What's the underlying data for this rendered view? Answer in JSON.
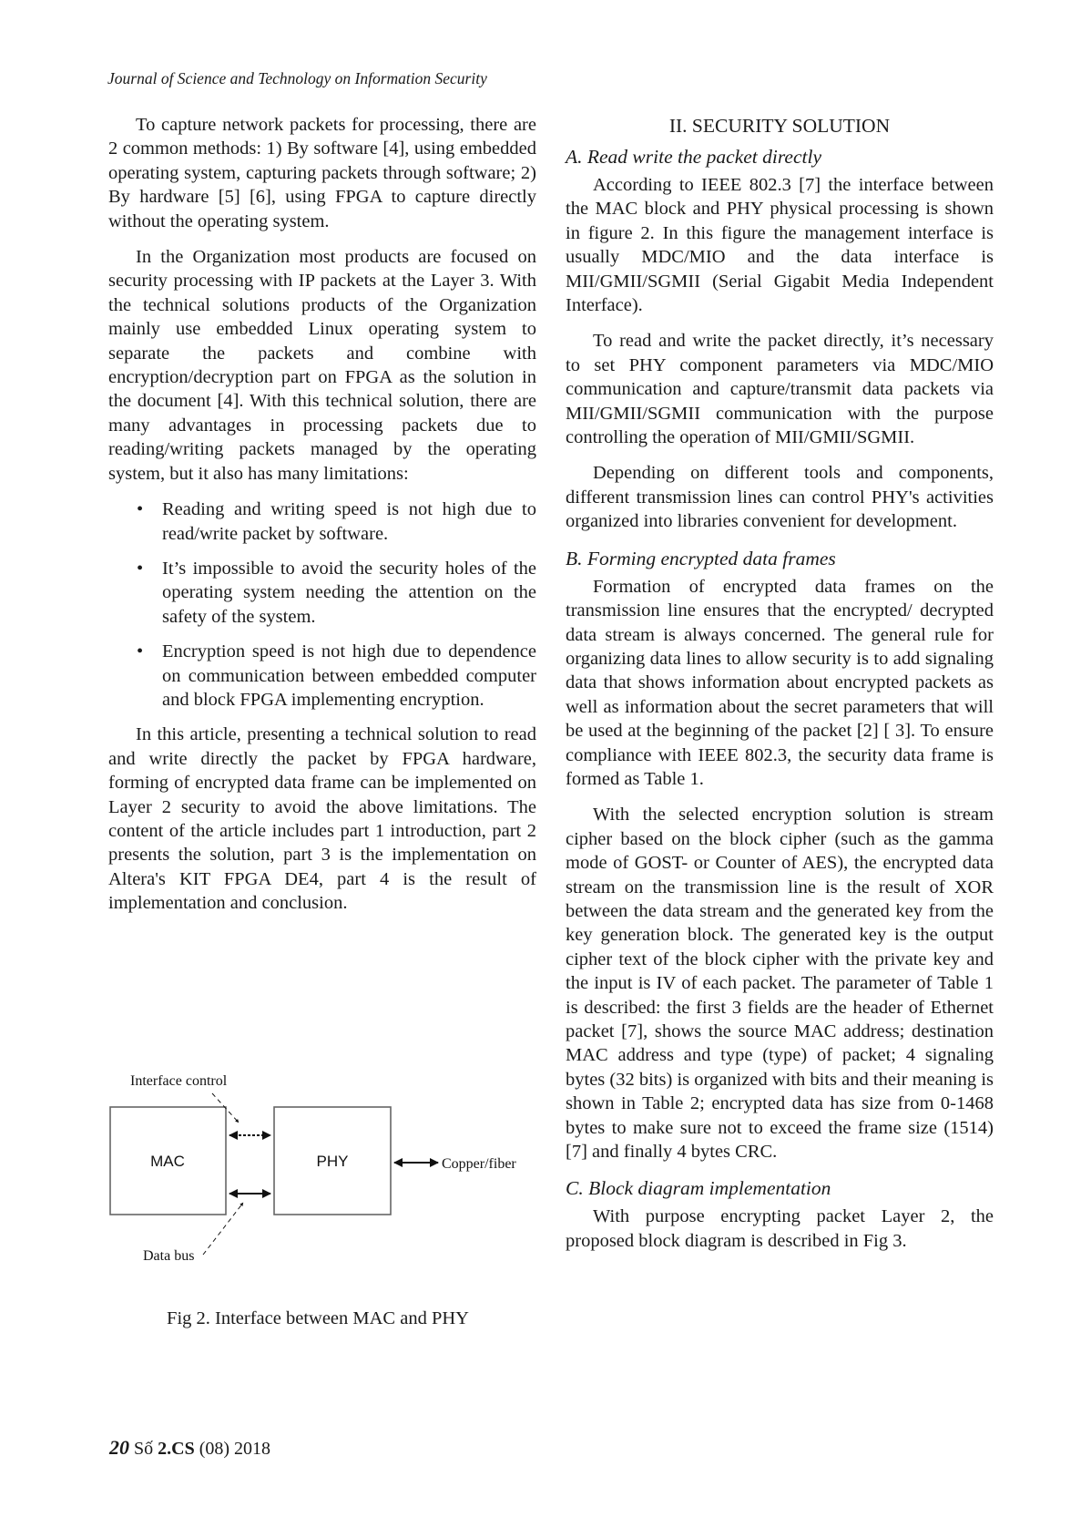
{
  "header": {
    "journal_title": "Journal of Science and Technology on Information Security"
  },
  "left_column": {
    "paragraphs": [
      "To capture network packets for processing, there are 2 common methods: 1) By software [4], using embedded operating system, capturing packets through software; 2) By hardware [5] [6], using FPGA to capture directly without the operating system.",
      "In the Organization most products are focused on security processing with IP packets at the Layer 3. With the technical solutions products of the Organization mainly use embedded Linux operating system to separate the packets and combine with encryption/decryption part on FPGA as the solution in the document [4]. With this technical solution, there are many advantages in processing packets due to reading/writing packets managed by the operating system, but it also has many limitations:"
    ],
    "bullet_symbol": "•",
    "bullets": [
      "Reading and writing speed is not high due to read/write packet by software.",
      "It’s impossible to avoid the security holes of the operating system needing the attention on the safety of the system.",
      "Encryption speed is not high due to dependence on communication between embedded computer and block FPGA implementing encryption."
    ],
    "closing_paragraph": "In this article, presenting a technical solution to read and write directly the packet by FPGA hardware, forming of encrypted data frame can be implemented on Layer 2 security to avoid the above limitations. The content of the article includes part 1 introduction, part 2 presents the solution, part 3 is the implementation on Altera's KIT FPGA DE4, part 4 is the result of implementation and conclusion."
  },
  "figure": {
    "labels": {
      "mac": "MAC",
      "phy": "PHY",
      "interface_control": "Interface control",
      "data_bus": "Data bus",
      "copper_fiber": "Copper/fiber"
    },
    "caption": "Fig 2. Interface between MAC and PHY"
  },
  "right_column": {
    "section_title": "II. SECURITY SOLUTION",
    "subsections": [
      {
        "title": "A.  Read write the packet directly",
        "paragraphs": [
          "According to IEEE 802.3 [7] the interface between the MAC block and PHY physical processing is shown in figure 2. In this figure the management interface is usually MDC/MIO and the data interface is MII/GMII/SGMII (Serial Gigabit Media Independent  Interface).",
          "To read and write the packet directly, it’s necessary to set PHY component parameters via MDC/MIO communication and capture/transmit data packets via MII/GMII/SGMII communication with the purpose controlling the operation of MII/GMII/SGMII.",
          "Depending on different tools and components, different transmission lines can control PHY's activities organized into libraries convenient for development."
        ]
      },
      {
        "title": "B. Forming encrypted data frames",
        "paragraphs": [
          "Formation of encrypted data frames on the transmission line ensures that the encrypted/ decrypted data stream is always concerned. The general rule for organizing data lines to allow security is to add signaling data that shows information about encrypted packets as well as information about the secret parameters that will be used at the beginning of the packet [2] [ 3]. To ensure compliance with IEEE 802.3, the security data frame is formed as Table 1.",
          "With the selected encryption solution is stream cipher based on the block cipher (such as the gamma mode of GOST- or Counter of AES), the encrypted data stream on the transmission line is the result of XOR between the data stream and the generated key from the key generation block. The generated key is the output cipher text of the block cipher with the private key and the input is IV of each packet. The parameter of Table 1 is described: the first 3 fields are the header of Ethernet packet [7], shows the source MAC address; destination MAC address and type (type) of packet; 4 signaling bytes (32 bits) is organized with bits and their meaning is shown in Table 2; encrypted data has size from 0-1468 bytes to make sure not to exceed the frame size (1514) [7] and finally 4 bytes CRC."
        ]
      },
      {
        "title": "C. Block diagram implementation",
        "paragraphs": [
          "With purpose encrypting packet Layer 2, the proposed block diagram is described in Fig 3."
        ]
      }
    ]
  },
  "footer": {
    "page_number": "20",
    "issue_prefix": "Số",
    "issue": "2.CS",
    "issue_suffix": "(08) 2018"
  }
}
